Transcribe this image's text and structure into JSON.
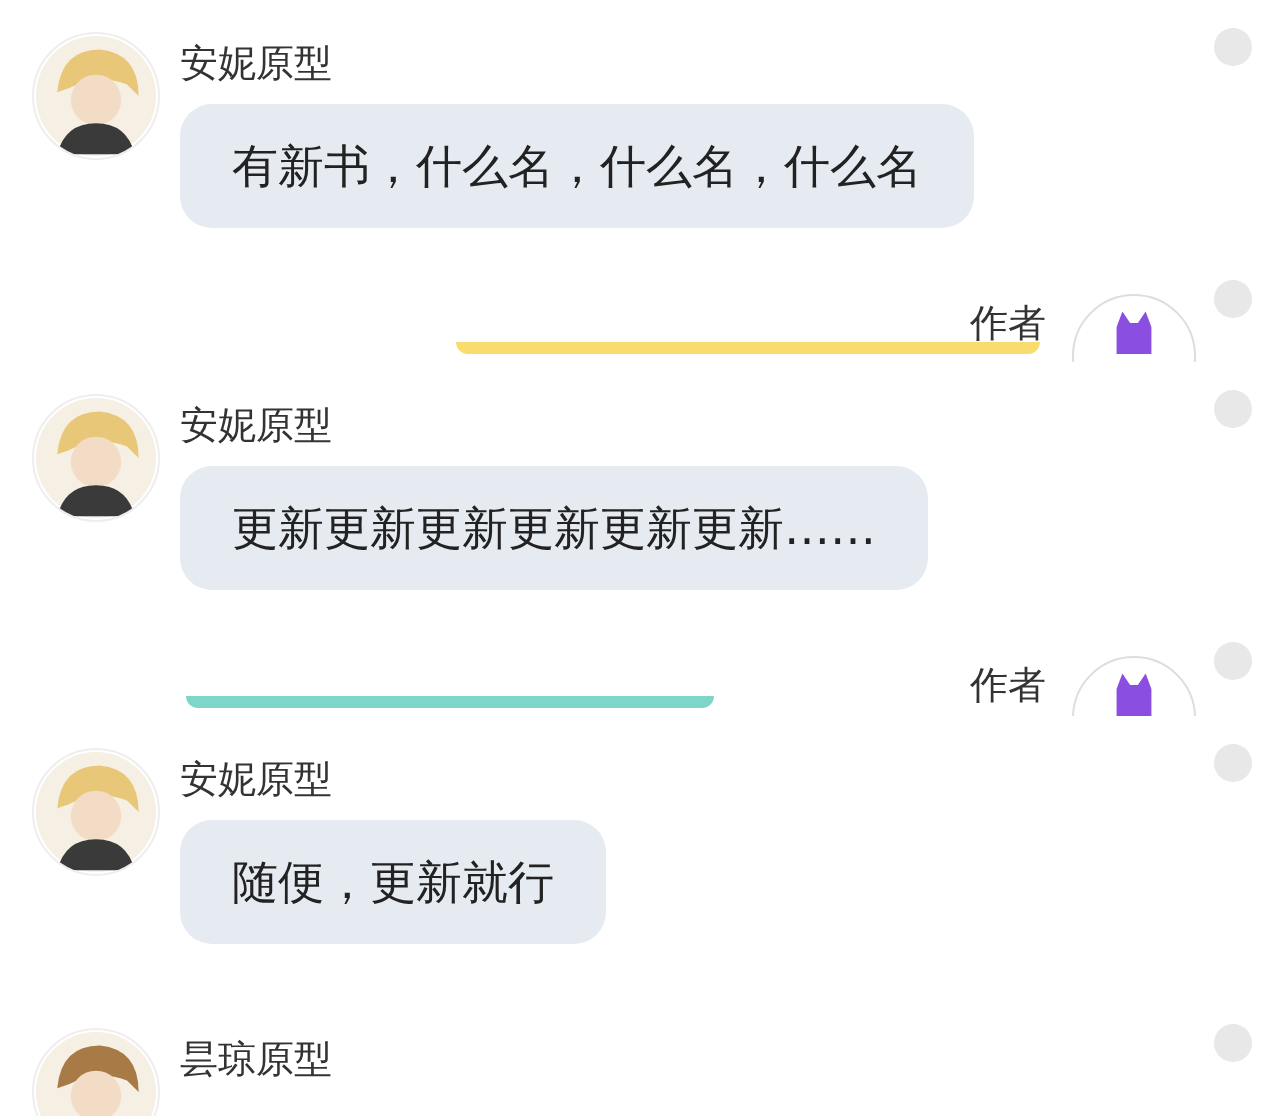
{
  "messages": [
    {
      "kind": "other",
      "name": "安妮原型",
      "text": "有新书，什么名，什么名，什么名",
      "selected": false
    },
    {
      "kind": "author",
      "name": "作者",
      "color": "#f9dc6e",
      "selected": false
    },
    {
      "kind": "other",
      "name": "安妮原型",
      "text": "更新更新更新更新更新更新……",
      "selected": false
    },
    {
      "kind": "author",
      "name": "作者",
      "color": "#7ed6c8",
      "selected": false
    },
    {
      "kind": "other",
      "name": "安妮原型",
      "text": "随便，更新就行",
      "selected": false
    },
    {
      "kind": "other",
      "name": "昙琼原型",
      "selected": false
    }
  ]
}
